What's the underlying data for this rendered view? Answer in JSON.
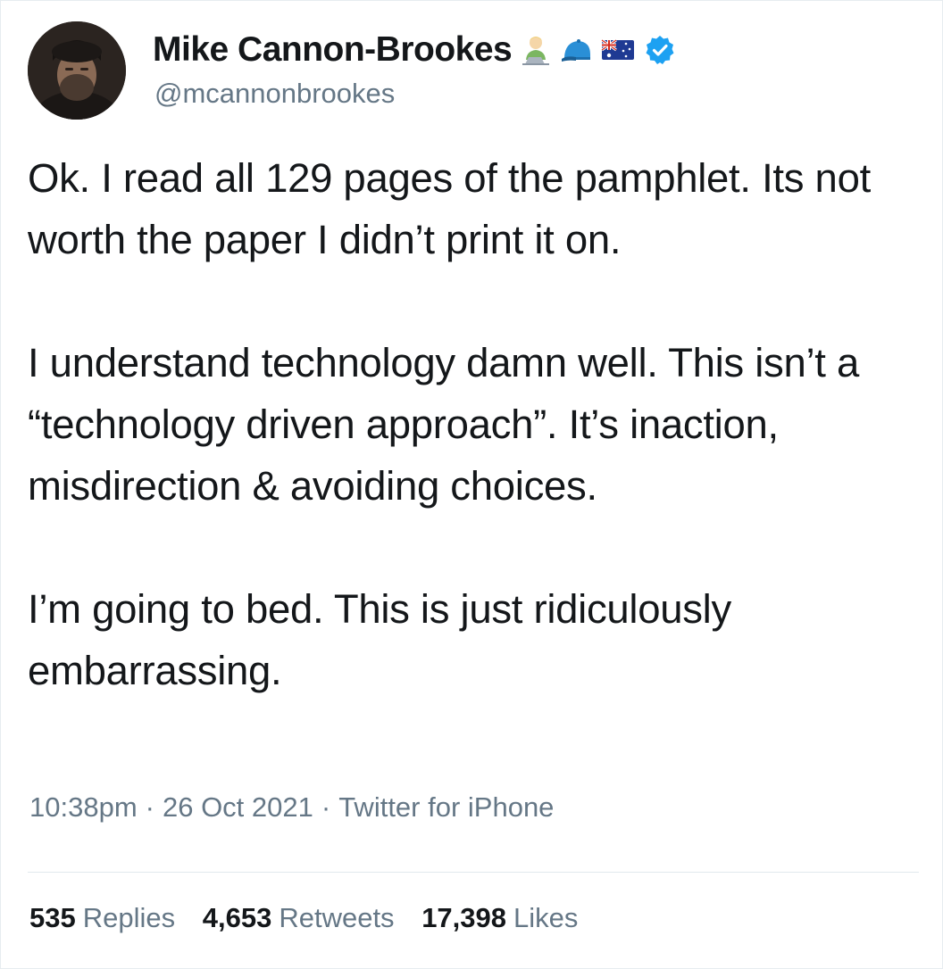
{
  "author": {
    "display_name": "Mike Cannon-Brookes",
    "handle": "@mcannonbrookes",
    "name_emojis": [
      "technologist-emoji",
      "cap-emoji",
      "australia-flag-emoji"
    ],
    "verified": true
  },
  "tweet": {
    "paragraphs": [
      "Ok. I read all 129 pages of the pamphlet. Its not worth the paper I didn’t print it on.",
      "I understand technology damn well. This isn’t a “technology driven approach”. It’s inaction, misdirection & avoiding choices.",
      "I’m going to bed. This is just ridiculously embarrassing."
    ],
    "time": "10:38pm",
    "date": "26 Oct 2021",
    "source": "Twitter for iPhone",
    "separator": "·"
  },
  "stats": {
    "replies_count": "535",
    "replies_label": "Replies",
    "retweets_count": "4,653",
    "retweets_label": "Retweets",
    "likes_count": "17,398",
    "likes_label": "Likes"
  },
  "colors": {
    "text_primary": "#14171a",
    "text_secondary": "#657786",
    "verified_blue": "#1da1f2",
    "divider": "#e1e8ed"
  }
}
